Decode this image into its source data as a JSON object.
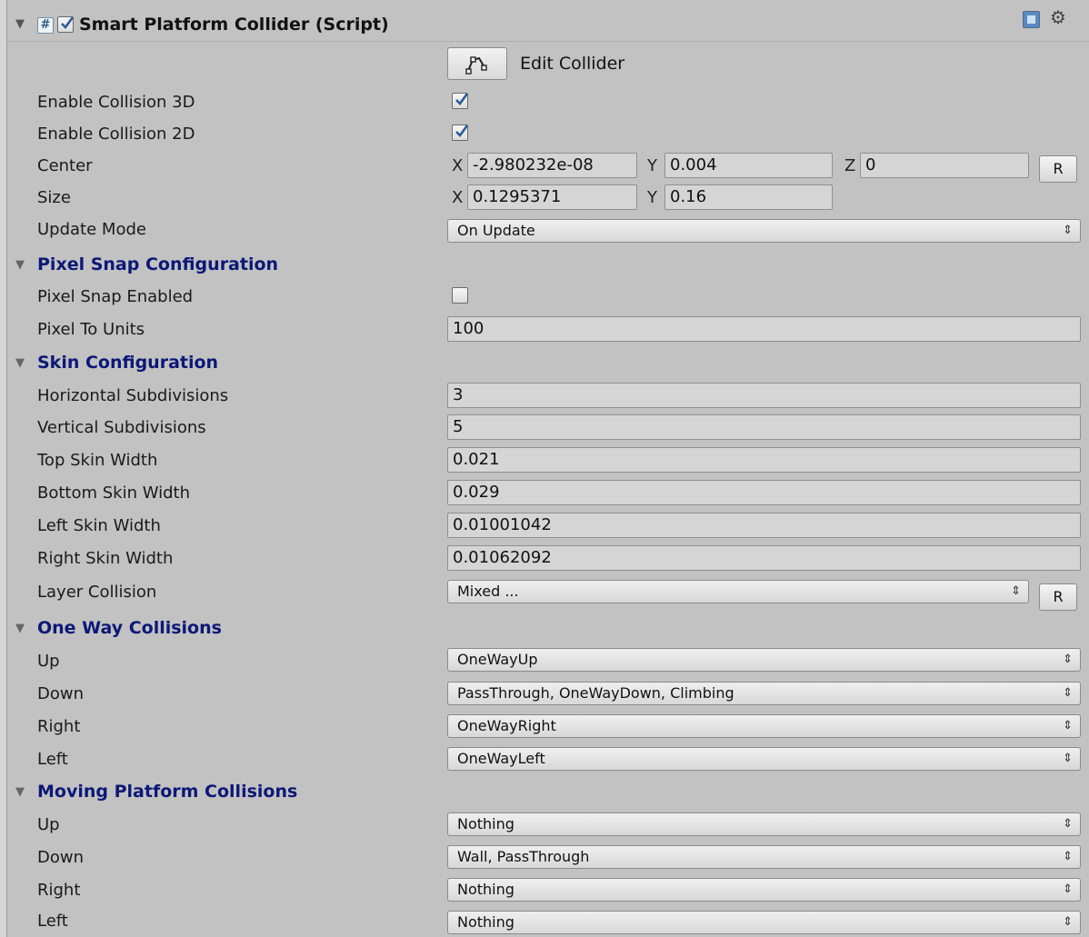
{
  "component": {
    "title": "Smart Platform Collider (Script)",
    "edit_collider_label": "Edit Collider"
  },
  "fields": {
    "enable_collision_3d": {
      "label": "Enable Collision 3D",
      "checked": true
    },
    "enable_collision_2d": {
      "label": "Enable Collision 2D",
      "checked": true
    },
    "center": {
      "label": "Center",
      "x_label": "X",
      "x": "-2.980232e-08",
      "y_label": "Y",
      "y": "0.004",
      "z_label": "Z",
      "z": "0",
      "reset": "R"
    },
    "size": {
      "label": "Size",
      "x_label": "X",
      "x": "0.1295371",
      "y_label": "Y",
      "y": "0.16"
    },
    "update_mode": {
      "label": "Update Mode",
      "value": "On Update"
    }
  },
  "pixel_snap": {
    "header": "Pixel Snap Configuration",
    "enabled_label": "Pixel Snap Enabled",
    "enabled": false,
    "ptu_label": "Pixel To Units",
    "ptu_value": "100"
  },
  "skin": {
    "header": "Skin Configuration",
    "rows": [
      {
        "label": "Horizontal Subdivisions",
        "value": "3"
      },
      {
        "label": "Vertical Subdivisions",
        "value": "5"
      },
      {
        "label": "Top Skin Width",
        "value": "0.021"
      },
      {
        "label": "Bottom Skin Width",
        "value": "0.029"
      },
      {
        "label": "Left Skin Width",
        "value": "0.01001042"
      },
      {
        "label": "Right Skin Width",
        "value": "0.01062092"
      }
    ],
    "layer_label": "Layer Collision",
    "layer_value": "Mixed ...",
    "layer_reset": "R"
  },
  "one_way": {
    "header": "One Way Collisions",
    "rows": [
      {
        "label": "Up",
        "value": "OneWayUp"
      },
      {
        "label": "Down",
        "value": "PassThrough, OneWayDown, Climbing"
      },
      {
        "label": "Right",
        "value": "OneWayRight"
      },
      {
        "label": "Left",
        "value": "OneWayLeft"
      }
    ]
  },
  "moving": {
    "header": "Moving Platform Collisions",
    "rows": [
      {
        "label": "Up",
        "value": "Nothing"
      },
      {
        "label": "Down",
        "value": "Wall, PassThrough"
      },
      {
        "label": "Right",
        "value": "Nothing"
      },
      {
        "label": "Left",
        "value": "Nothing"
      }
    ]
  },
  "icons": {
    "foldout": "triangle-down",
    "dropdown": "updown-arrows",
    "gear": "gear-icon",
    "help": "help-book-icon"
  }
}
